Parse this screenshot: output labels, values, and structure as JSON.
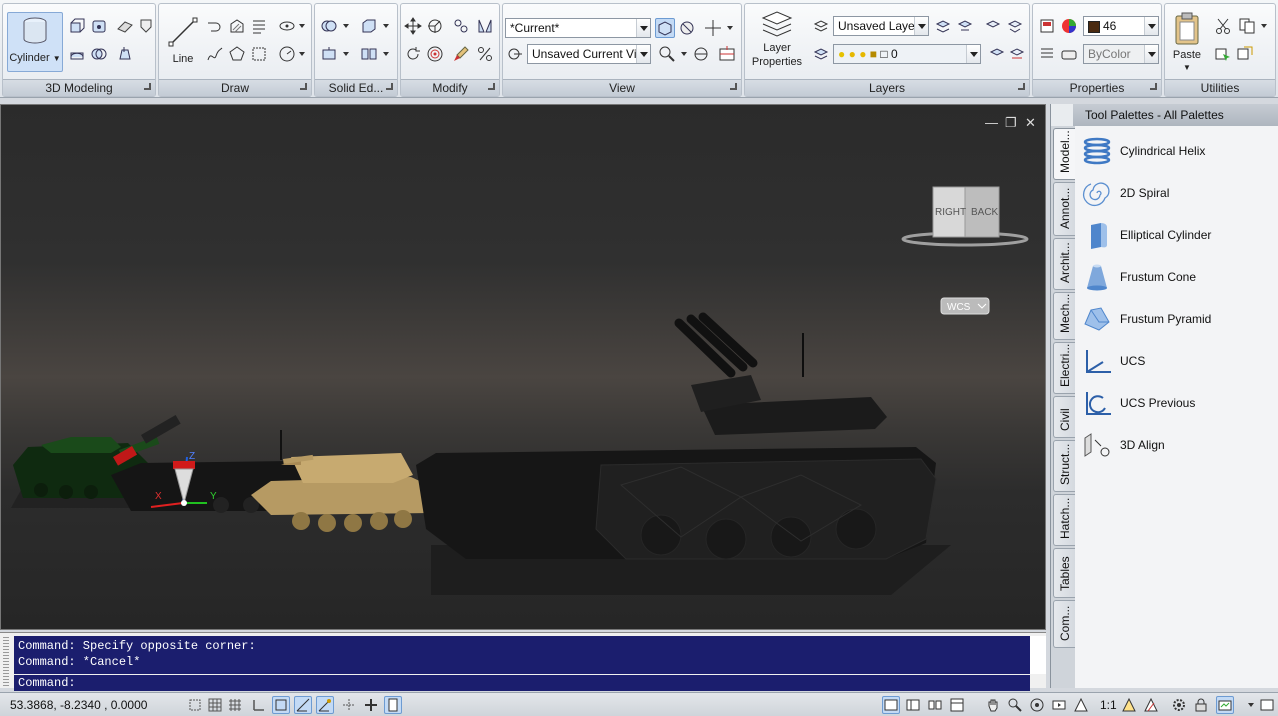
{
  "ribbon": {
    "panels": {
      "modeling": "3D Modeling",
      "draw": "Draw",
      "solid_edit": "Solid Ed...",
      "modify": "Modify",
      "view": "View",
      "layers": "Layers",
      "properties": "Properties",
      "utilities": "Utilities"
    },
    "cylinder_label": "Cylinder",
    "line_label": "Line",
    "layer_properties_label": "Layer\nProperties",
    "paste_label": "Paste",
    "visual_style": "*Current*",
    "view_combo": "Unsaved Current Vie",
    "layer_state": "Unsaved Laye",
    "layer_current": "0",
    "color_value": "46",
    "linetype_value": "ByColor"
  },
  "viewport": {
    "viewcube_right": "RIGHT",
    "viewcube_back": "BACK",
    "wcs_label": "WCS",
    "ucs_x": "X",
    "ucs_y": "Y",
    "ucs_z": "Z"
  },
  "palette": {
    "title": "Tool Palettes - All Palettes",
    "tabs": [
      "Model...",
      "Annot...",
      "Archit...",
      "Mech...",
      "Electri...",
      "Civil",
      "Struct...",
      "Hatch...",
      "Tables",
      "Com..."
    ],
    "items": [
      {
        "label": "Cylindrical Helix",
        "icon": "helix-icon"
      },
      {
        "label": "2D Spiral",
        "icon": "spiral-icon"
      },
      {
        "label": "Elliptical Cylinder",
        "icon": "elliptical-cylinder-icon"
      },
      {
        "label": "Frustum Cone",
        "icon": "frustum-cone-icon"
      },
      {
        "label": "Frustum Pyramid",
        "icon": "frustum-pyramid-icon"
      },
      {
        "label": "UCS",
        "icon": "ucs-icon"
      },
      {
        "label": "UCS Previous",
        "icon": "ucs-previous-icon"
      },
      {
        "label": "3D Align",
        "icon": "align-3d-icon"
      }
    ]
  },
  "command": {
    "history": [
      "Command: Specify opposite corner:",
      "Command: *Cancel*"
    ],
    "prompt": "Command:"
  },
  "status": {
    "coordinates": "53.3868,   -8.2340  , 0.0000",
    "annotation_scale": "1:1"
  },
  "colors": {
    "command_bg": "#1b1e6e",
    "accent": "#6d9bd2",
    "color_swatch": "#4a2a10"
  }
}
